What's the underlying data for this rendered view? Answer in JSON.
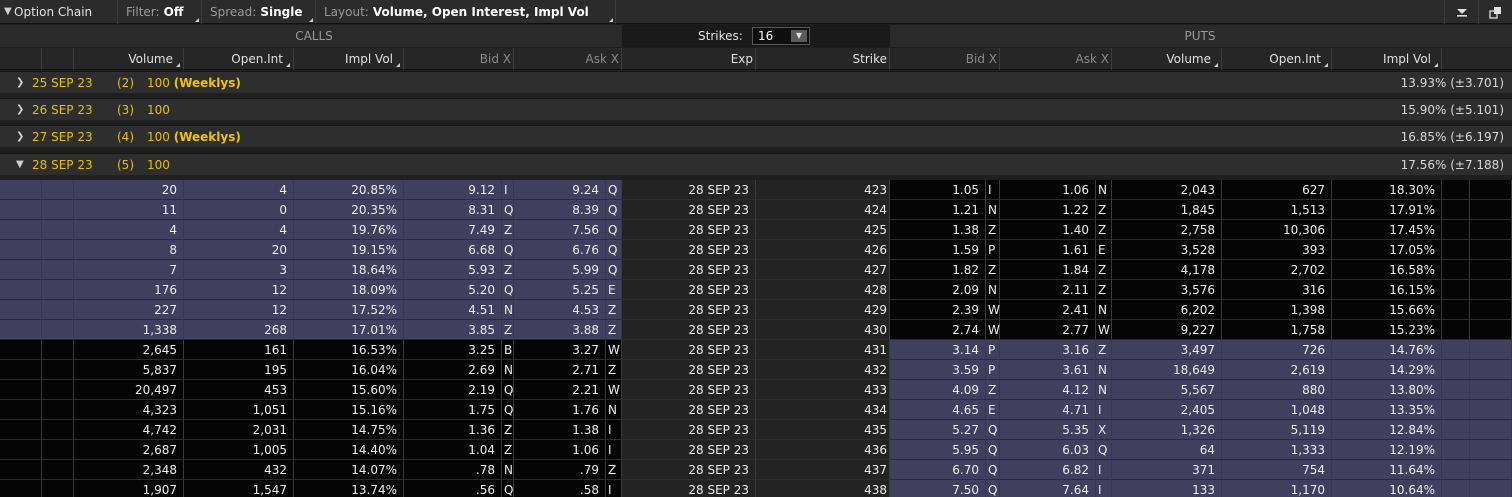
{
  "toolbar": {
    "title": "Option Chain",
    "filter_label": "Filter:",
    "filter_value": "Off",
    "spread_label": "Spread:",
    "spread_value": "Single",
    "layout_label": "Layout:",
    "layout_value": "Volume, Open Interest, Impl Vol",
    "menu_icon": "chevron-down-icon",
    "popout_icon": "popout-icon"
  },
  "groups": {
    "calls": "CALLS",
    "puts": "PUTS",
    "strikes_label": "Strikes:",
    "strikes_value": "16"
  },
  "columns": {
    "calls": [
      "Volume",
      "Open.Int",
      "Impl Vol",
      "Bid X",
      "Ask X"
    ],
    "mid": [
      "Exp",
      "Strike"
    ],
    "puts": [
      "Bid X",
      "Ask X",
      "Volume",
      "Open.Int",
      "Impl Vol"
    ]
  },
  "expirations": [
    {
      "date": "25 SEP 23",
      "count": "(2)",
      "mult": "100",
      "tag": "(Weeklys)",
      "iv": "13.93% (±3.701)",
      "expanded": false
    },
    {
      "date": "26 SEP 23",
      "count": "(3)",
      "mult": "100",
      "tag": "",
      "iv": "15.90% (±5.101)",
      "expanded": false
    },
    {
      "date": "27 SEP 23",
      "count": "(4)",
      "mult": "100",
      "tag": "(Weeklys)",
      "iv": "16.85% (±6.197)",
      "expanded": false
    },
    {
      "date": "28 SEP 23",
      "count": "(5)",
      "mult": "100",
      "tag": "",
      "iv": "17.56% (±7.188)",
      "expanded": true
    }
  ],
  "rows": [
    {
      "cv": "20",
      "coi": "4",
      "civ": "20.85%",
      "cb": "9.12",
      "cbx": "I",
      "ca": "9.24",
      "cax": "Q",
      "exp": "28 SEP 23",
      "strike": "423",
      "pb": "1.05",
      "pbx": "I",
      "pa": "1.06",
      "pax": "N",
      "pv": "2,043",
      "poi": "627",
      "piv": "18.30%"
    },
    {
      "cv": "11",
      "coi": "0",
      "civ": "20.35%",
      "cb": "8.31",
      "cbx": "Q",
      "ca": "8.39",
      "cax": "Q",
      "exp": "28 SEP 23",
      "strike": "424",
      "pb": "1.21",
      "pbx": "N",
      "pa": "1.22",
      "pax": "Z",
      "pv": "1,845",
      "poi": "1,513",
      "piv": "17.91%"
    },
    {
      "cv": "4",
      "coi": "4",
      "civ": "19.76%",
      "cb": "7.49",
      "cbx": "Z",
      "ca": "7.56",
      "cax": "Q",
      "exp": "28 SEP 23",
      "strike": "425",
      "pb": "1.38",
      "pbx": "Z",
      "pa": "1.40",
      "pax": "Z",
      "pv": "2,758",
      "poi": "10,306",
      "piv": "17.45%"
    },
    {
      "cv": "8",
      "coi": "20",
      "civ": "19.15%",
      "cb": "6.68",
      "cbx": "Q",
      "ca": "6.76",
      "cax": "Q",
      "exp": "28 SEP 23",
      "strike": "426",
      "pb": "1.59",
      "pbx": "P",
      "pa": "1.61",
      "pax": "E",
      "pv": "3,528",
      "poi": "393",
      "piv": "17.05%"
    },
    {
      "cv": "7",
      "coi": "3",
      "civ": "18.64%",
      "cb": "5.93",
      "cbx": "Z",
      "ca": "5.99",
      "cax": "Q",
      "exp": "28 SEP 23",
      "strike": "427",
      "pb": "1.82",
      "pbx": "Z",
      "pa": "1.84",
      "pax": "Z",
      "pv": "4,178",
      "poi": "2,702",
      "piv": "16.58%"
    },
    {
      "cv": "176",
      "coi": "12",
      "civ": "18.09%",
      "cb": "5.20",
      "cbx": "Q",
      "ca": "5.25",
      "cax": "E",
      "exp": "28 SEP 23",
      "strike": "428",
      "pb": "2.09",
      "pbx": "N",
      "pa": "2.11",
      "pax": "Z",
      "pv": "3,576",
      "poi": "316",
      "piv": "16.15%"
    },
    {
      "cv": "227",
      "coi": "12",
      "civ": "17.52%",
      "cb": "4.51",
      "cbx": "N",
      "ca": "4.53",
      "cax": "Z",
      "exp": "28 SEP 23",
      "strike": "429",
      "pb": "2.39",
      "pbx": "W",
      "pa": "2.41",
      "pax": "N",
      "pv": "6,202",
      "poi": "1,398",
      "piv": "15.66%"
    },
    {
      "cv": "1,338",
      "coi": "268",
      "civ": "17.01%",
      "cb": "3.85",
      "cbx": "Z",
      "ca": "3.88",
      "cax": "Z",
      "exp": "28 SEP 23",
      "strike": "430",
      "pb": "2.74",
      "pbx": "W",
      "pa": "2.77",
      "pax": "W",
      "pv": "9,227",
      "poi": "1,758",
      "piv": "15.23%"
    },
    {
      "cv": "2,645",
      "coi": "161",
      "civ": "16.53%",
      "cb": "3.25",
      "cbx": "B",
      "ca": "3.27",
      "cax": "W",
      "exp": "28 SEP 23",
      "strike": "431",
      "pb": "3.14",
      "pbx": "P",
      "pa": "3.16",
      "pax": "Z",
      "pv": "3,497",
      "poi": "726",
      "piv": "14.76%"
    },
    {
      "cv": "5,837",
      "coi": "195",
      "civ": "16.04%",
      "cb": "2.69",
      "cbx": "N",
      "ca": "2.71",
      "cax": "Z",
      "exp": "28 SEP 23",
      "strike": "432",
      "pb": "3.59",
      "pbx": "P",
      "pa": "3.61",
      "pax": "N",
      "pv": "18,649",
      "poi": "2,619",
      "piv": "14.29%"
    },
    {
      "cv": "20,497",
      "coi": "453",
      "civ": "15.60%",
      "cb": "2.19",
      "cbx": "Q",
      "ca": "2.21",
      "cax": "W",
      "exp": "28 SEP 23",
      "strike": "433",
      "pb": "4.09",
      "pbx": "Z",
      "pa": "4.12",
      "pax": "N",
      "pv": "5,567",
      "poi": "880",
      "piv": "13.80%"
    },
    {
      "cv": "4,323",
      "coi": "1,051",
      "civ": "15.16%",
      "cb": "1.75",
      "cbx": "Q",
      "ca": "1.76",
      "cax": "N",
      "exp": "28 SEP 23",
      "strike": "434",
      "pb": "4.65",
      "pbx": "E",
      "pa": "4.71",
      "pax": "I",
      "pv": "2,405",
      "poi": "1,048",
      "piv": "13.35%"
    },
    {
      "cv": "4,742",
      "coi": "2,031",
      "civ": "14.75%",
      "cb": "1.36",
      "cbx": "Z",
      "ca": "1.38",
      "cax": "I",
      "exp": "28 SEP 23",
      "strike": "435",
      "pb": "5.27",
      "pbx": "Q",
      "pa": "5.35",
      "pax": "X",
      "pv": "1,326",
      "poi": "5,119",
      "piv": "12.84%"
    },
    {
      "cv": "2,687",
      "coi": "1,005",
      "civ": "14.40%",
      "cb": "1.04",
      "cbx": "Z",
      "ca": "1.06",
      "cax": "I",
      "exp": "28 SEP 23",
      "strike": "436",
      "pb": "5.95",
      "pbx": "Q",
      "pa": "6.03",
      "pax": "Q",
      "pv": "64",
      "poi": "1,333",
      "piv": "12.19%"
    },
    {
      "cv": "2,348",
      "coi": "432",
      "civ": "14.07%",
      "cb": ".78",
      "cbx": "N",
      "ca": ".79",
      "cax": "Z",
      "exp": "28 SEP 23",
      "strike": "437",
      "pb": "6.70",
      "pbx": "Q",
      "pa": "6.82",
      "pax": "I",
      "pv": "371",
      "poi": "754",
      "piv": "11.64%"
    },
    {
      "cv": "1,907",
      "coi": "1,547",
      "civ": "13.74%",
      "cb": ".56",
      "cbx": "Q",
      "ca": ".58",
      "cax": "I",
      "exp": "28 SEP 23",
      "strike": "438",
      "pb": "7.50",
      "pbx": "Q",
      "pa": "7.64",
      "pax": "I",
      "pv": "133",
      "poi": "1,170",
      "piv": "10.64%"
    }
  ],
  "itm_call_rows": 8,
  "colors": {
    "itm": "#40405e",
    "otm": "#050505",
    "accent": "#e3c000"
  }
}
